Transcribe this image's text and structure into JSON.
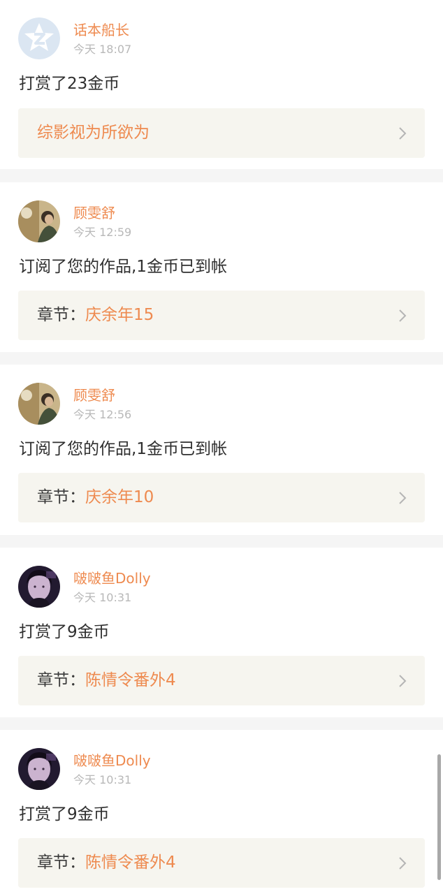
{
  "notifications": [
    {
      "user": "话本船长",
      "time": "今天 18:07",
      "message": "打赏了23金币",
      "link_prefix": "",
      "link_title": "综影视为所欲为",
      "avatar_icon": "z-logo-icon"
    },
    {
      "user": "顾雯舒",
      "time": "今天 12:59",
      "message": "订阅了您的作品,1金币已到帐",
      "link_prefix": "章节：",
      "link_title": "庆余年15",
      "avatar_icon": "person-photo-avatar"
    },
    {
      "user": "顾雯舒",
      "time": "今天 12:56",
      "message": "订阅了您的作品,1金币已到帐",
      "link_prefix": "章节：",
      "link_title": "庆余年10",
      "avatar_icon": "person-photo-avatar"
    },
    {
      "user": "啵啵鱼Dolly",
      "time": "今天 10:31",
      "message": "打赏了9金币",
      "link_prefix": "章节：",
      "link_title": "陈情令番外4",
      "avatar_icon": "portrait-photo-avatar"
    },
    {
      "user": "啵啵鱼Dolly",
      "time": "今天 10:31",
      "message": "打赏了9金币",
      "link_prefix": "章节：",
      "link_title": "陈情令番外4",
      "avatar_icon": "portrait-photo-avatar"
    }
  ],
  "colors": {
    "accent": "#ee8a4f",
    "link_box_bg": "#f6f5ef",
    "divider_bg": "#f5f5f5"
  }
}
